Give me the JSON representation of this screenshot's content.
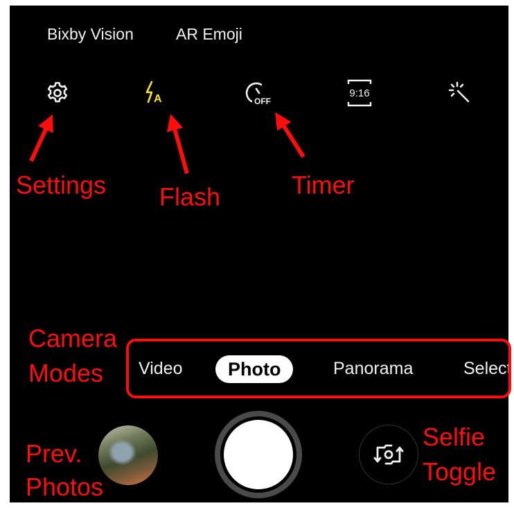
{
  "top_bar": {
    "bixby_vision": "Bixby Vision",
    "ar_emoji": "AR Emoji"
  },
  "icons": {
    "settings": "gear-icon",
    "flash": "flash-auto-icon",
    "flash_glyph": "A",
    "timer": "timer-off-icon",
    "timer_glyph": "OFF",
    "ratio": "aspect-ratio-icon",
    "ratio_label": "9:16",
    "effects": "magic-wand-icon"
  },
  "modes": {
    "items": [
      "Video",
      "Photo",
      "Panorama",
      "Select"
    ],
    "active": "Photo"
  },
  "annotations": {
    "settings": "Settings",
    "flash": "Flash",
    "timer": "Timer",
    "camera_modes_1": "Camera",
    "camera_modes_2": "Modes",
    "prev_photos_1": "Prev.",
    "prev_photos_2": "Photos",
    "selfie_toggle_1": "Selfie",
    "selfie_toggle_2": "Toggle"
  },
  "colors": {
    "annotation_red": "#ff0d0d",
    "flash_yellow": "#ffe42a",
    "screen_bg": "#000000"
  }
}
